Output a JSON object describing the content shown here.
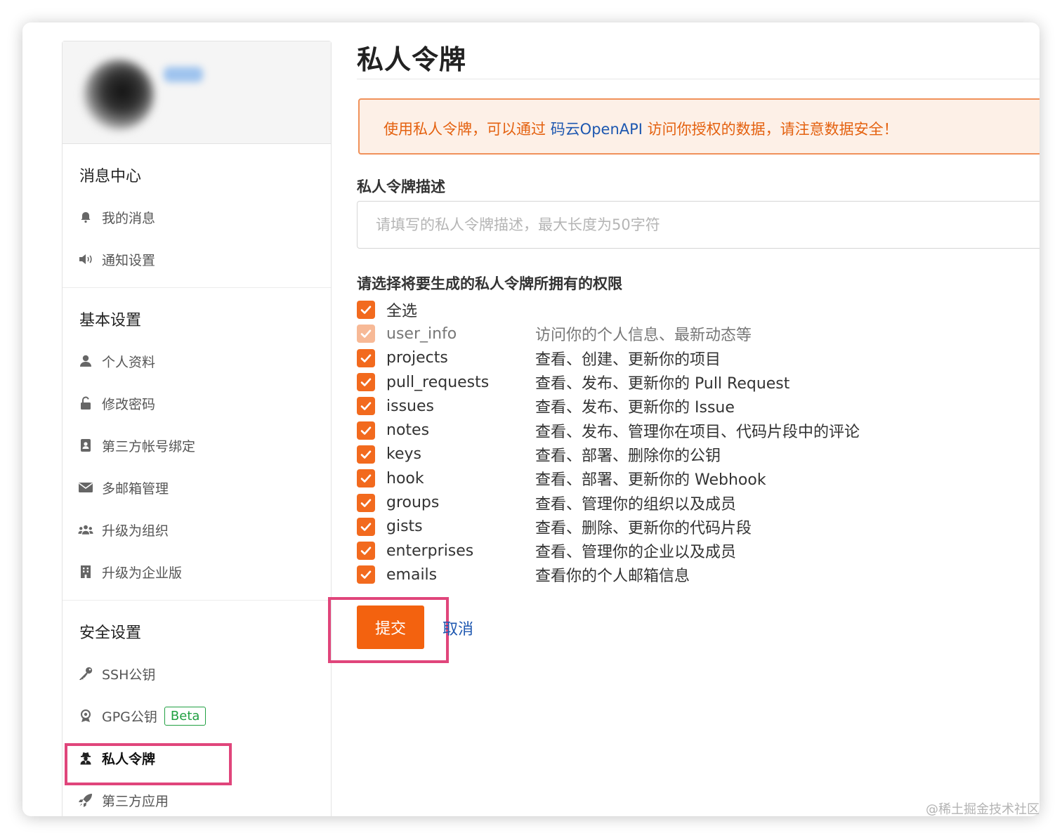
{
  "sidebar": {
    "sections": [
      {
        "title": "消息中心",
        "items": [
          {
            "label": "我的消息",
            "icon": "bell-icon"
          },
          {
            "label": "通知设置",
            "icon": "speaker-icon"
          }
        ]
      },
      {
        "title": "基本设置",
        "items": [
          {
            "label": "个人资料",
            "icon": "user-icon"
          },
          {
            "label": "修改密码",
            "icon": "unlock-icon"
          },
          {
            "label": "第三方帐号绑定",
            "icon": "contact-book-icon"
          },
          {
            "label": "多邮箱管理",
            "icon": "envelope-icon"
          },
          {
            "label": "升级为组织",
            "icon": "users-icon"
          },
          {
            "label": "升级为企业版",
            "icon": "building-icon"
          }
        ]
      },
      {
        "title": "安全设置",
        "items": [
          {
            "label": "SSH公钥",
            "icon": "key-icon"
          },
          {
            "label": "GPG公钥",
            "icon": "seal-icon",
            "badge": "Beta"
          },
          {
            "label": "私人令牌",
            "icon": "user-secret-icon",
            "active": true
          },
          {
            "label": "第三方应用",
            "icon": "rocket-icon"
          }
        ]
      }
    ]
  },
  "main": {
    "title": "私人令牌",
    "alert": {
      "prefix": "使用私人令牌，可以通过 ",
      "link": "码云OpenAPI",
      "suffix": " 访问你授权的数据，请注意数据安全！"
    },
    "desc_label": "私人令牌描述",
    "desc_placeholder": "请填写的私人令牌描述，最大长度为50字符",
    "perm_label": "请选择将要生成的私人令牌所拥有的权限",
    "select_all": "全选",
    "permissions": [
      {
        "name": "user_info",
        "desc": "访问你的个人信息、最新动态等",
        "disabled": true
      },
      {
        "name": "projects",
        "desc": "查看、创建、更新你的项目"
      },
      {
        "name": "pull_requests",
        "desc": "查看、发布、更新你的 Pull Request"
      },
      {
        "name": "issues",
        "desc": "查看、发布、更新你的 Issue"
      },
      {
        "name": "notes",
        "desc": "查看、发布、管理你在项目、代码片段中的评论"
      },
      {
        "name": "keys",
        "desc": "查看、部署、删除你的公钥"
      },
      {
        "name": "hook",
        "desc": "查看、部署、更新你的 Webhook"
      },
      {
        "name": "groups",
        "desc": "查看、管理你的组织以及成员"
      },
      {
        "name": "gists",
        "desc": "查看、删除、更新你的代码片段"
      },
      {
        "name": "enterprises",
        "desc": "查看、管理你的企业以及成员"
      },
      {
        "name": "emails",
        "desc": "查看你的个人邮箱信息"
      }
    ],
    "submit_label": "提交",
    "cancel_label": "取消"
  },
  "watermark": "@稀土掘金技术社区",
  "colors": {
    "accent": "#f3620f",
    "link": "#1d57b0",
    "badge": "#21a042",
    "highlight": "#e0457b"
  }
}
